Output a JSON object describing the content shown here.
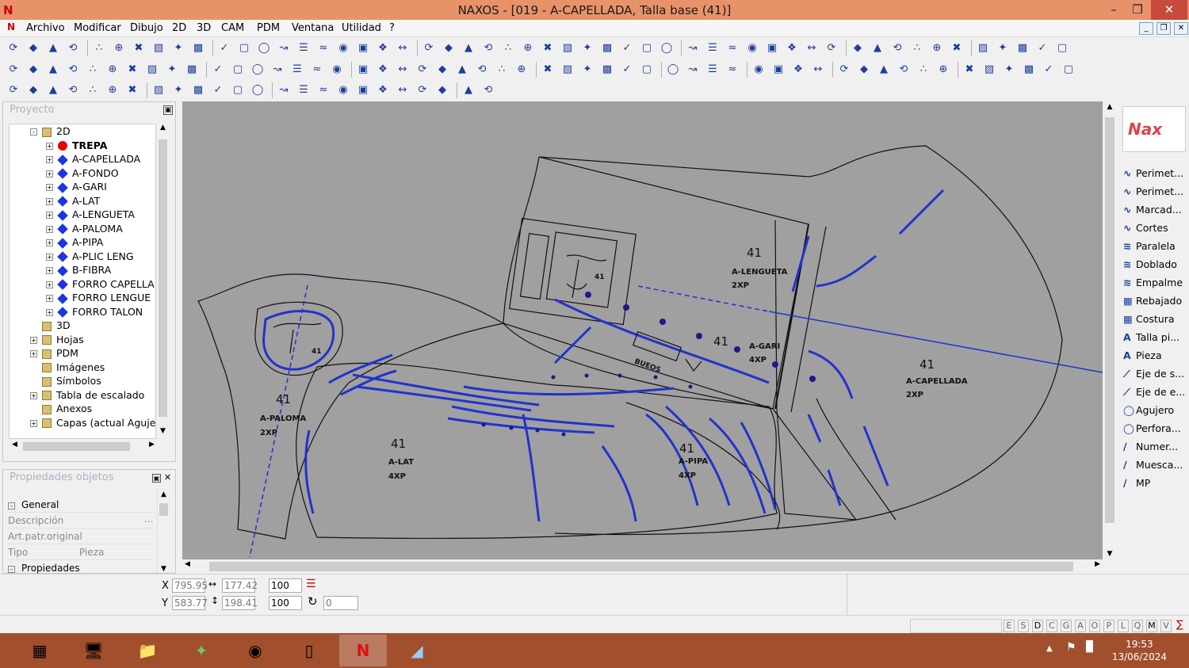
{
  "window": {
    "title": "NAXOS - [019 - A-CAPELLADA, Talla base (41)]",
    "logo": "N"
  },
  "menu": [
    "Archivo",
    "Modificar",
    "Dibujo",
    "2D",
    "3D",
    "CAM",
    "PDM",
    "Ventana",
    "Utilidad",
    "?"
  ],
  "project_panel": {
    "title": "Proyecto",
    "tree": [
      {
        "label": "2D",
        "icon": "folder-2d-icon",
        "level": 0
      },
      {
        "label": "TREPA",
        "icon": "red-dot-icon",
        "level": 1,
        "bold": true
      },
      {
        "label": "A-CAPELLADA",
        "icon": "blue-diamond-icon",
        "level": 1
      },
      {
        "label": "A-FONDO",
        "icon": "blue-diamond-icon",
        "level": 1
      },
      {
        "label": "A-GARI",
        "icon": "blue-diamond-icon",
        "level": 1
      },
      {
        "label": "A-LAT",
        "icon": "blue-diamond-icon",
        "level": 1
      },
      {
        "label": "A-LENGUETA",
        "icon": "blue-diamond-icon",
        "level": 1
      },
      {
        "label": "A-PALOMA",
        "icon": "blue-diamond-icon",
        "level": 1
      },
      {
        "label": "A-PIPA",
        "icon": "blue-diamond-icon",
        "level": 1
      },
      {
        "label": "A-PLIC LENG",
        "icon": "blue-diamond-icon",
        "level": 1
      },
      {
        "label": "B-FIBRA",
        "icon": "blue-diamond-icon",
        "level": 1
      },
      {
        "label": "FORRO CAPELLA",
        "icon": "blue-diamond-icon",
        "level": 1
      },
      {
        "label": "FORRO LENGUE",
        "icon": "blue-diamond-icon",
        "level": 1
      },
      {
        "label": "FORRO TALON",
        "icon": "blue-diamond-icon",
        "level": 1
      },
      {
        "label": "3D",
        "icon": "3d-icon",
        "level": 0
      },
      {
        "label": "Hojas",
        "icon": "sheets-icon",
        "level": 0
      },
      {
        "label": "PDM",
        "icon": "pdm-folder-icon",
        "level": 0
      },
      {
        "label": "Imágenes",
        "icon": "images-icon",
        "level": 0
      },
      {
        "label": "Símbolos",
        "icon": "symbols-icon",
        "level": 0
      },
      {
        "label": "Tabla de escalado",
        "icon": "table-icon",
        "level": 0
      },
      {
        "label": "Anexos",
        "icon": "attachment-icon",
        "level": 0
      },
      {
        "label": "Capas (actual Agujeros",
        "icon": "layers-icon",
        "level": 0
      }
    ]
  },
  "properties_panel": {
    "title": "Propiedades objetos",
    "sections": {
      "general": "General",
      "properties": "Propiedades"
    },
    "rows": [
      {
        "label": "Descripción",
        "value": ""
      },
      {
        "label": "Art.patr.original",
        "value": ""
      },
      {
        "label": "Tipo",
        "value": "Pieza"
      }
    ]
  },
  "canvas": {
    "pieces": [
      {
        "size": "41",
        "name": "A-LENGUETA",
        "qty": "2XP"
      },
      {
        "size": "41",
        "name": "A-GARI",
        "qty": "4XP"
      },
      {
        "size": "41",
        "name": "A-CAPELLADA",
        "qty": "2XP"
      },
      {
        "size": "41",
        "name": "A-PALOMA",
        "qty": "2XP"
      },
      {
        "size": "41",
        "name": "A-LAT",
        "qty": "4XP"
      },
      {
        "size": "41",
        "name": "A-PIPA",
        "qty": "4XP"
      }
    ],
    "logo_size": "41",
    "stamp": "41",
    "bueos": "BUEOS"
  },
  "right_panel": {
    "logo": "Nax",
    "tools": [
      {
        "label": "Perimet...",
        "icon": "curve-icon"
      },
      {
        "label": "Perimet...",
        "icon": "curve-icon"
      },
      {
        "label": "Marcad...",
        "icon": "curve-icon"
      },
      {
        "label": "Cortes",
        "icon": "curve-icon"
      },
      {
        "label": "Paralela",
        "icon": "parallel-icon"
      },
      {
        "label": "Doblado",
        "icon": "fold-icon"
      },
      {
        "label": "Empalme",
        "icon": "join-icon"
      },
      {
        "label": "Rebajado",
        "icon": "skive-icon"
      },
      {
        "label": "Costura",
        "icon": "seam-icon"
      },
      {
        "label": "Talla pi...",
        "icon": "text-a-icon"
      },
      {
        "label": "Pieza",
        "icon": "text-a-icon"
      },
      {
        "label": "Eje de s...",
        "icon": "axis-icon"
      },
      {
        "label": "Eje de e...",
        "icon": "axis-icon"
      },
      {
        "label": "Agujero",
        "icon": "circle-icon"
      },
      {
        "label": "Perfora...",
        "icon": "circle-icon"
      },
      {
        "label": "Numer...",
        "icon": "pen-icon"
      },
      {
        "label": "Muesca...",
        "icon": "pen-icon"
      },
      {
        "label": "MP",
        "icon": "pen-icon"
      }
    ]
  },
  "coords": {
    "x_label": "X",
    "y_label": "Y",
    "x": "795.95",
    "y": "583.77",
    "w": "177.42",
    "h": "198.41",
    "sx": "100",
    "sy": "100",
    "angle": "0"
  },
  "status_letters": [
    "E",
    "S",
    "D",
    "C",
    "G",
    "A",
    "O",
    "P",
    "L",
    "Q",
    "M",
    "V"
  ],
  "clock": {
    "time": "19:53",
    "date": "13/06/2024"
  }
}
